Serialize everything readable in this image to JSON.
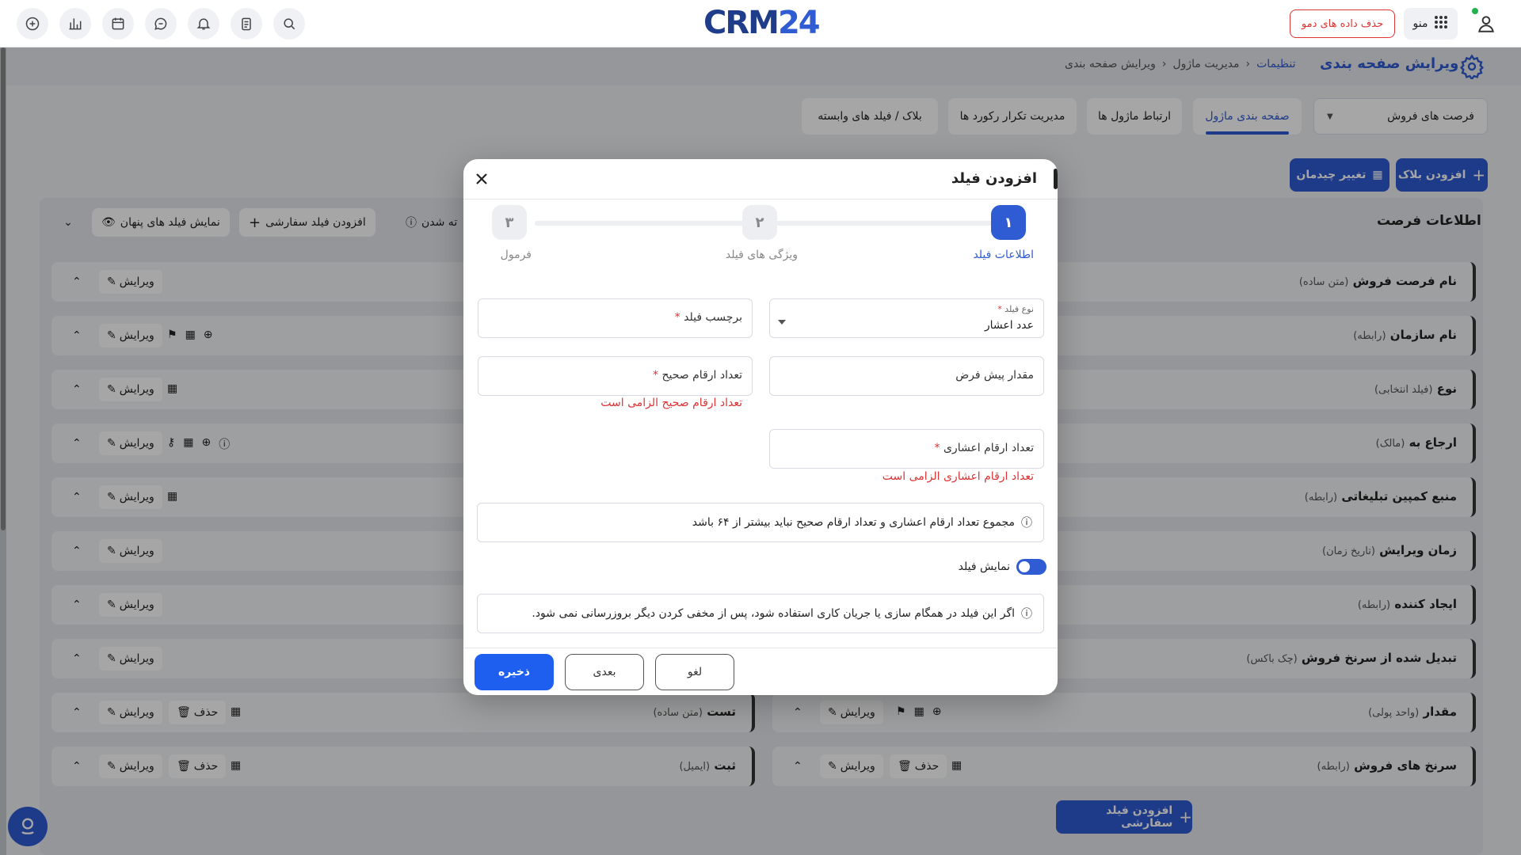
{
  "app": {
    "logo_text": "CRM",
    "logo_num": "24",
    "demo_button": "حذف داده های دمو",
    "menu_label": "منو"
  },
  "page": {
    "title": "ویرایش صفحه بندی",
    "breadcrumb": [
      "تنظیمات",
      "مدیریت ماژول",
      "ویرایش صفحه بندی"
    ],
    "module_select": "فرصت های فروش",
    "tabs": [
      "صفحه بندی ماژول",
      "ارتباط ماژول ها",
      "مدیریت تکرار رکورد ها",
      "بلاک / فیلد های وابسته"
    ],
    "add_block": "افزودن بلاک",
    "change_layout": "تغییر چیدمان",
    "section_title": "اطلاعات فرصت",
    "show_hidden": "نمایش فیلد های پنهان",
    "add_custom": "افزودن فیلد سفارشی",
    "collapse_text": "ته شدن",
    "edit_label": "ویرایش",
    "delete_label": "حذف",
    "rows_right": [
      {
        "name": "نام فرصت فروش",
        "type": "(متن ساده)"
      },
      {
        "name": "نام سازمان",
        "type": "(رابطه)"
      },
      {
        "name": "نوع",
        "type": "(فیلد انتخابی)"
      },
      {
        "name": "ارجاع به",
        "type": "(مالک)"
      },
      {
        "name": "منبع کمپین تبلیغاتی",
        "type": "(رابطه)"
      },
      {
        "name": "زمان ویرایش",
        "type": "(تاریخ زمان)"
      },
      {
        "name": "ایجاد کننده",
        "type": "(رابطه)"
      },
      {
        "name": "تبدیل شده از سرنخ فروش",
        "type": "(چک باکس)"
      },
      {
        "name": "مقدار",
        "type": "(واحد پولی)"
      },
      {
        "name": "سرنخ های فروش",
        "type": "(رابطه)"
      }
    ],
    "rows_left": [
      {
        "name": "تست",
        "type": "(متن ساده)"
      },
      {
        "name": "ثبت",
        "type": "(ایمیل)"
      }
    ],
    "add_custom_bottom": "افزودن فیلد سفارشی"
  },
  "modal": {
    "title": "افزودن فیلد",
    "steps": [
      {
        "num": "۱",
        "label": "اطلاعات فیلد"
      },
      {
        "num": "۲",
        "label": "ویژگی های فیلد"
      },
      {
        "num": "۳",
        "label": "فرمول"
      }
    ],
    "field_type_label": "نوع فیلد",
    "field_type_value": "عدد اعشار",
    "field_label": "برچسب فیلد",
    "default_value": "مقدار پیش فرض",
    "integer_digits": "تعداد ارقام صحیح",
    "integer_error": "تعداد ارقام صحیح الزامی است",
    "decimal_digits": "تعداد ارقام اعشاری",
    "decimal_error": "تعداد ارقام اعشاری الزامی است",
    "info_digits": "مجموع تعداد ارقام اعشاری و تعداد ارقام صحیح نباید بیشتر از ۶۴ باشد",
    "show_field": "نمایش فیلد",
    "info_sync": "اگر این فیلد در همگام سازی یا جریان کاری استفاده شود، پس از مخفی کردن دیگر بروزرسانی نمی شود.",
    "save": "ذخیره",
    "next": "بعدی",
    "cancel": "لغو"
  },
  "colors": {
    "accent": "#2f5bd3",
    "danger": "#d33333"
  }
}
